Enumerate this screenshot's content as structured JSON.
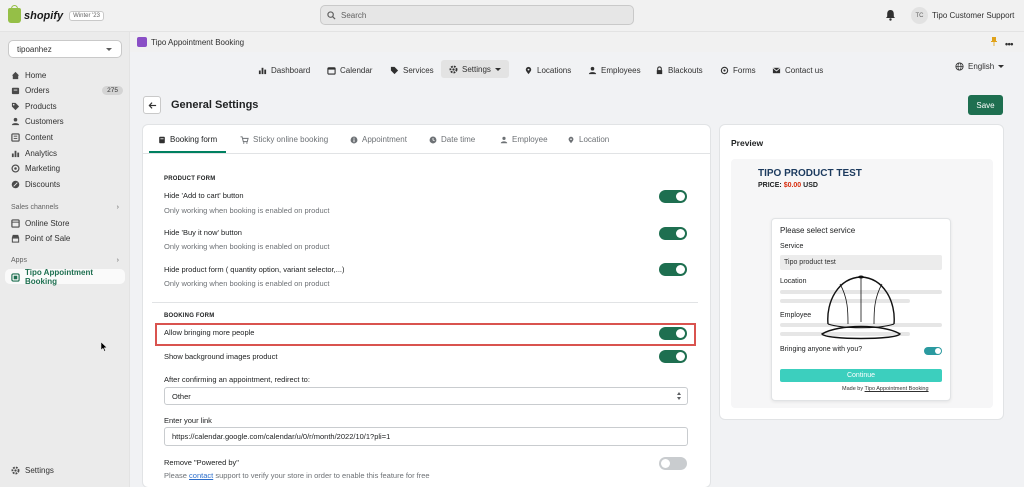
{
  "topbar": {
    "brand": "shopify",
    "edition": "Winter '23",
    "search_placeholder": "Search",
    "avatar_initials": "TC",
    "store_owner": "Tipo Customer Support"
  },
  "sidebar": {
    "store": "tipoanhez",
    "items": [
      {
        "label": "Home"
      },
      {
        "label": "Orders",
        "badge": "275"
      },
      {
        "label": "Products"
      },
      {
        "label": "Customers"
      },
      {
        "label": "Content"
      },
      {
        "label": "Analytics"
      },
      {
        "label": "Marketing"
      },
      {
        "label": "Discounts"
      }
    ],
    "sales_channels_heading": "Sales channels",
    "sales_channels": [
      {
        "label": "Online Store"
      },
      {
        "label": "Point of Sale"
      }
    ],
    "apps_heading": "Apps",
    "apps": [
      {
        "label": "Tipo Appointment Booking"
      }
    ],
    "settings": "Settings"
  },
  "app": {
    "title": "Tipo Appointment Booking",
    "more": "•••"
  },
  "topnav": {
    "items": [
      {
        "label": "Dashboard"
      },
      {
        "label": "Calendar"
      },
      {
        "label": "Services"
      },
      {
        "label": "Settings"
      },
      {
        "label": "Locations"
      },
      {
        "label": "Employees"
      },
      {
        "label": "Blackouts"
      },
      {
        "label": "Forms"
      },
      {
        "label": "Contact us"
      }
    ],
    "language": "English"
  },
  "page": {
    "title": "General Settings",
    "save": "Save"
  },
  "tabs": [
    {
      "label": "Booking form"
    },
    {
      "label": "Sticky online booking"
    },
    {
      "label": "Appointment"
    },
    {
      "label": "Date time"
    },
    {
      "label": "Employee"
    },
    {
      "label": "Location"
    }
  ],
  "product_form": {
    "heading": "PRODUCT FORM",
    "options": [
      {
        "label": "Hide 'Add to cart' button",
        "help": "Only working when booking is enabled on product",
        "enabled": true
      },
      {
        "label": "Hide 'Buy it now' button",
        "help": "Only working when booking is enabled on product",
        "enabled": true
      },
      {
        "label": "Hide product form ( quantity option, variant selector,...)",
        "help": "Only working when booking is enabled on product",
        "enabled": true
      }
    ]
  },
  "booking_form": {
    "heading": "BOOKING FORM",
    "allow_more_people": {
      "label": "Allow bringing more people",
      "enabled": true
    },
    "show_bg_images": {
      "label": "Show background images product",
      "enabled": true
    },
    "redirect_label": "After confirming an appointment, redirect to:",
    "redirect_value": "Other",
    "link_label": "Enter your link",
    "link_value": "https://calendar.google.com/calendar/u/0/r/month/2022/10/1?pli=1",
    "powered_by": {
      "label": "Remove \"Powered by\"",
      "enabled": false
    },
    "help_prefix": "Please",
    "help_link": "contact",
    "help_suffix": "support to verify your store in order to enable this feature for free"
  },
  "preview": {
    "title": "Preview",
    "product_title": "TIPO PRODUCT TEST",
    "price_label": "PRICE:",
    "price_value": "$0.00",
    "currency": "USD",
    "modal_title": "Please select service",
    "service_label": "Service",
    "service_value": "Tipo product test",
    "location_label": "Location",
    "employee_label": "Employee",
    "bringing_label": "Bringing anyone with you?",
    "continue": "Continue",
    "made_by_prefix": "Made by",
    "made_by_link": "Tipo Appointment Booking"
  },
  "colors": {
    "accent": "#1e6f50",
    "highlight": "#d9534f",
    "preview_button": "#3ccfbe",
    "preview_title": "#1c3a5e"
  }
}
